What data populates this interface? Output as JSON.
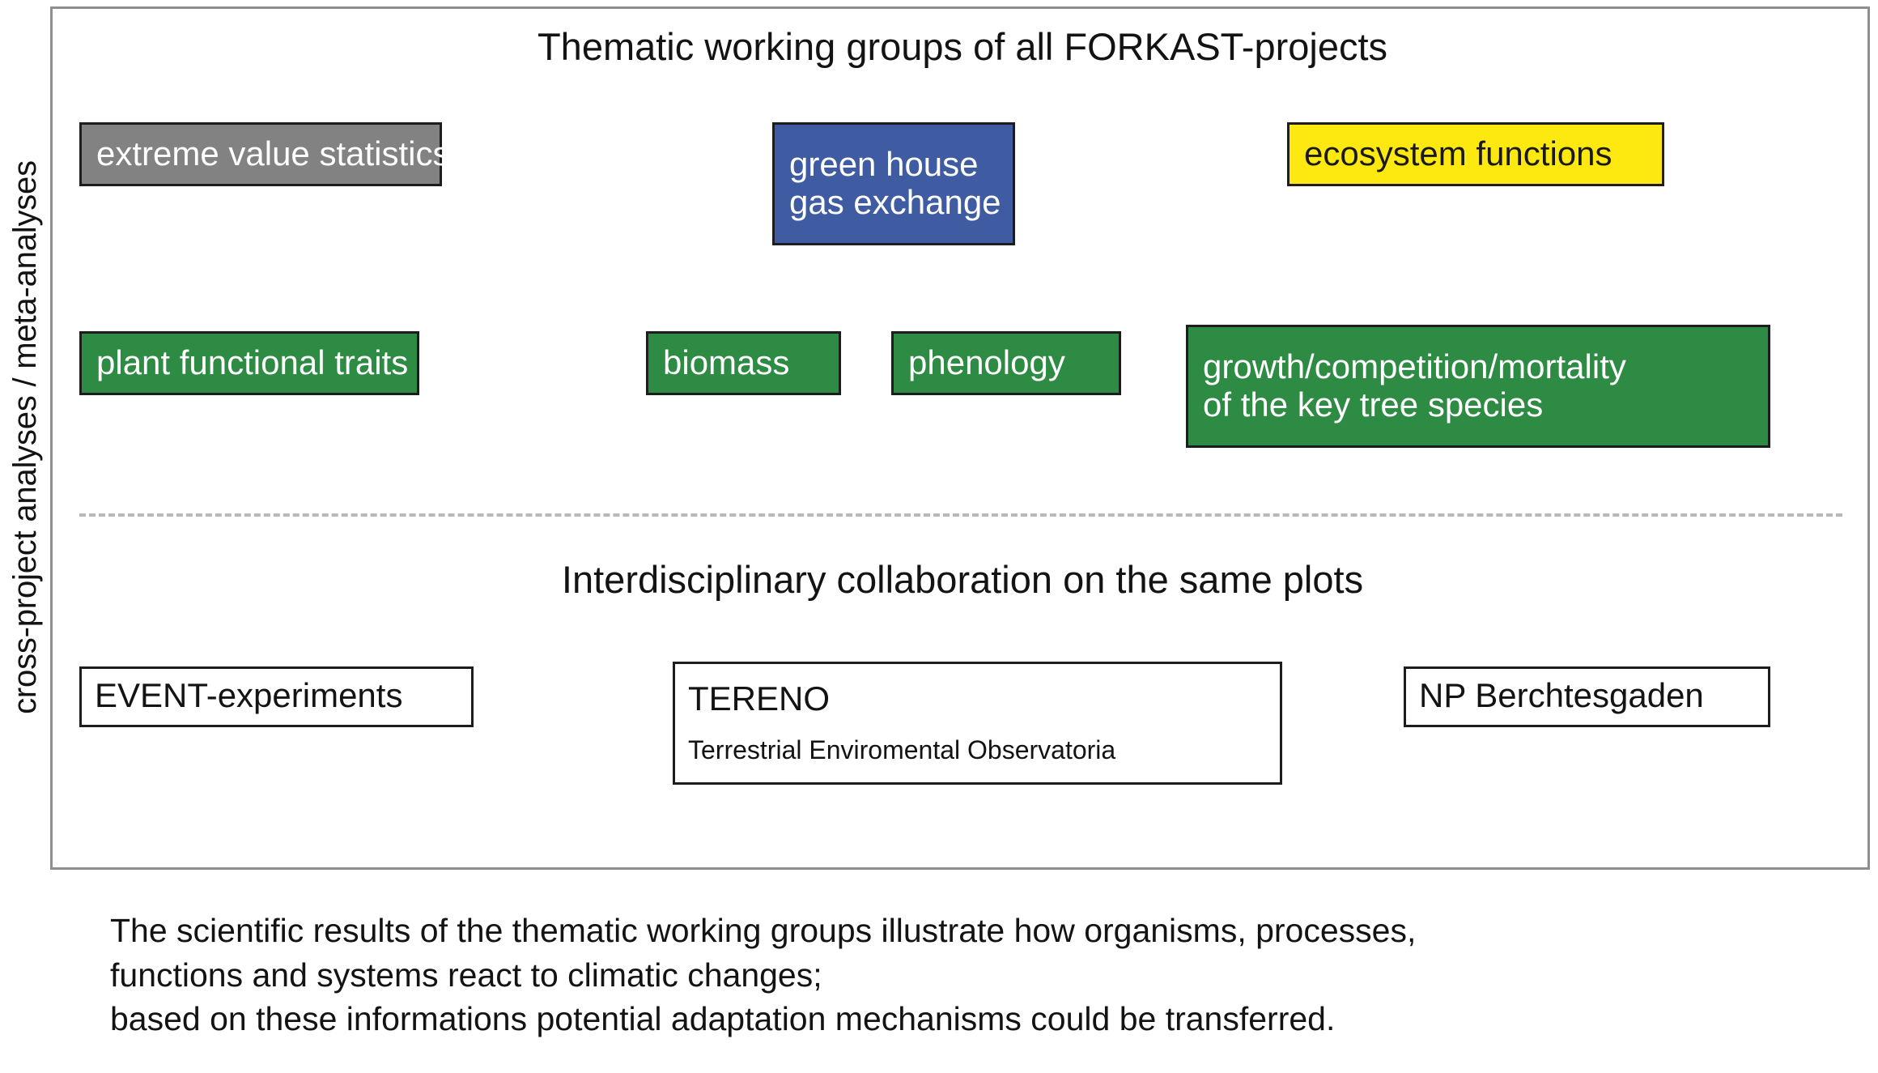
{
  "side_label": "cross-project analyses / meta-analyses",
  "sections": {
    "thematic_title": "Thematic working groups of all FORKAST-projects",
    "interdisciplinary_title": "Interdisciplinary collaboration on the same plots"
  },
  "colors": {
    "gray": "#828282",
    "blue": "#3f5ba2",
    "yellow": "#fde910",
    "green": "#2e8b43",
    "frame_border": "#8e8e8e",
    "box_border": "#1d1d1d",
    "divider": "#b9b9b9",
    "text_dark": "#131313",
    "text_light": "#ffffff"
  },
  "working_groups_row1": [
    {
      "label_line1": "extreme value statistics",
      "label_line2": "",
      "color": "gray"
    },
    {
      "label_line1": "green house",
      "label_line2": "gas exchange",
      "color": "blue"
    },
    {
      "label_line1": "ecosystem functions",
      "label_line2": "",
      "color": "yellow"
    }
  ],
  "working_groups_row2": [
    {
      "label_line1": "plant functional traits",
      "label_line2": "",
      "color": "green"
    },
    {
      "label_line1": "biomass",
      "label_line2": "",
      "color": "green"
    },
    {
      "label_line1": "phenology",
      "label_line2": "",
      "color": "green"
    },
    {
      "label_line1": "growth/competition/mortality",
      "label_line2": "of the key tree species",
      "color": "green"
    }
  ],
  "platforms": [
    {
      "name": "EVENT-experiments",
      "subtitle": ""
    },
    {
      "name": "TERENO",
      "subtitle": "Terrestrial Enviromental Observatoria"
    },
    {
      "name": "NP Berchtesgaden",
      "subtitle": ""
    }
  ],
  "caption": {
    "line1": "The scientific results of the thematic working groups illustrate how organisms, processes,",
    "line2": "functions and systems react to climatic changes;",
    "line3": "based on these informations potential adaptation mechanisms could be transferred."
  }
}
